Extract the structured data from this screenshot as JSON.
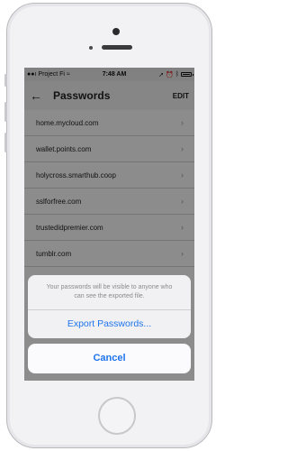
{
  "status_bar": {
    "carrier": "Project Fi",
    "time": "7:48 AM",
    "icons": [
      "signal-icon",
      "wifi-icon",
      "location-icon",
      "alarm-icon",
      "bluetooth-icon",
      "battery-icon"
    ]
  },
  "app_bar": {
    "back_icon": "←",
    "title": "Passwords",
    "edit_label": "EDIT"
  },
  "passwords": [
    "home.mycloud.com",
    "wallet.points.com",
    "holycross.smarthub.coop",
    "sslforfree.com",
    "trustedidpremier.com",
    "tumblr.com"
  ],
  "row_chevron": "›",
  "action_sheet": {
    "message": "Your passwords will be visible to anyone who can see the exported file.",
    "action_label": "Export Passwords...",
    "cancel_label": "Cancel"
  },
  "colors": {
    "accent": "#1e74ec"
  }
}
